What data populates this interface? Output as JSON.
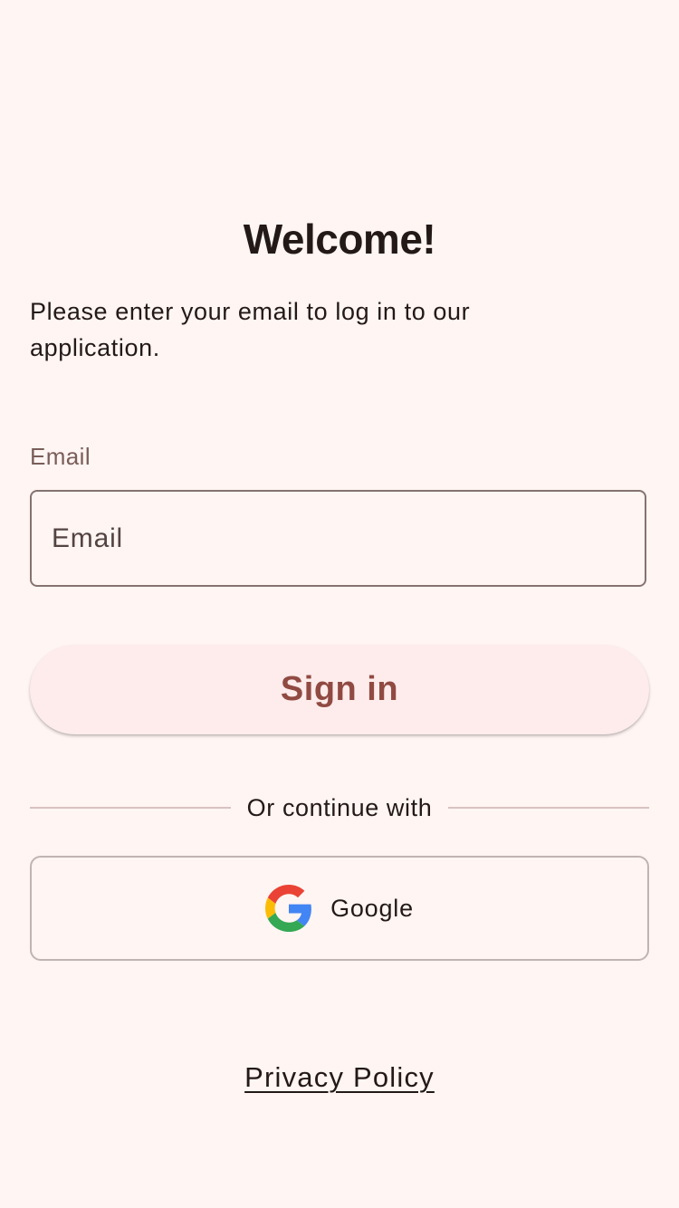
{
  "screen": {
    "background_color": "#fff5f3"
  },
  "header": {
    "title": "Welcome!",
    "subtitle": "Please enter your email to log in to our application."
  },
  "email_field": {
    "label": "Email",
    "placeholder": "Email",
    "value": ""
  },
  "sign_in": {
    "label": "Sign in",
    "background_color": "#fdeceb",
    "text_color": "#904a42"
  },
  "divider": {
    "label": "Or continue with"
  },
  "social": {
    "google": {
      "label": "Google",
      "icon": "google-logo-icon"
    }
  },
  "footer": {
    "privacy_policy_label": "Privacy Policy"
  }
}
